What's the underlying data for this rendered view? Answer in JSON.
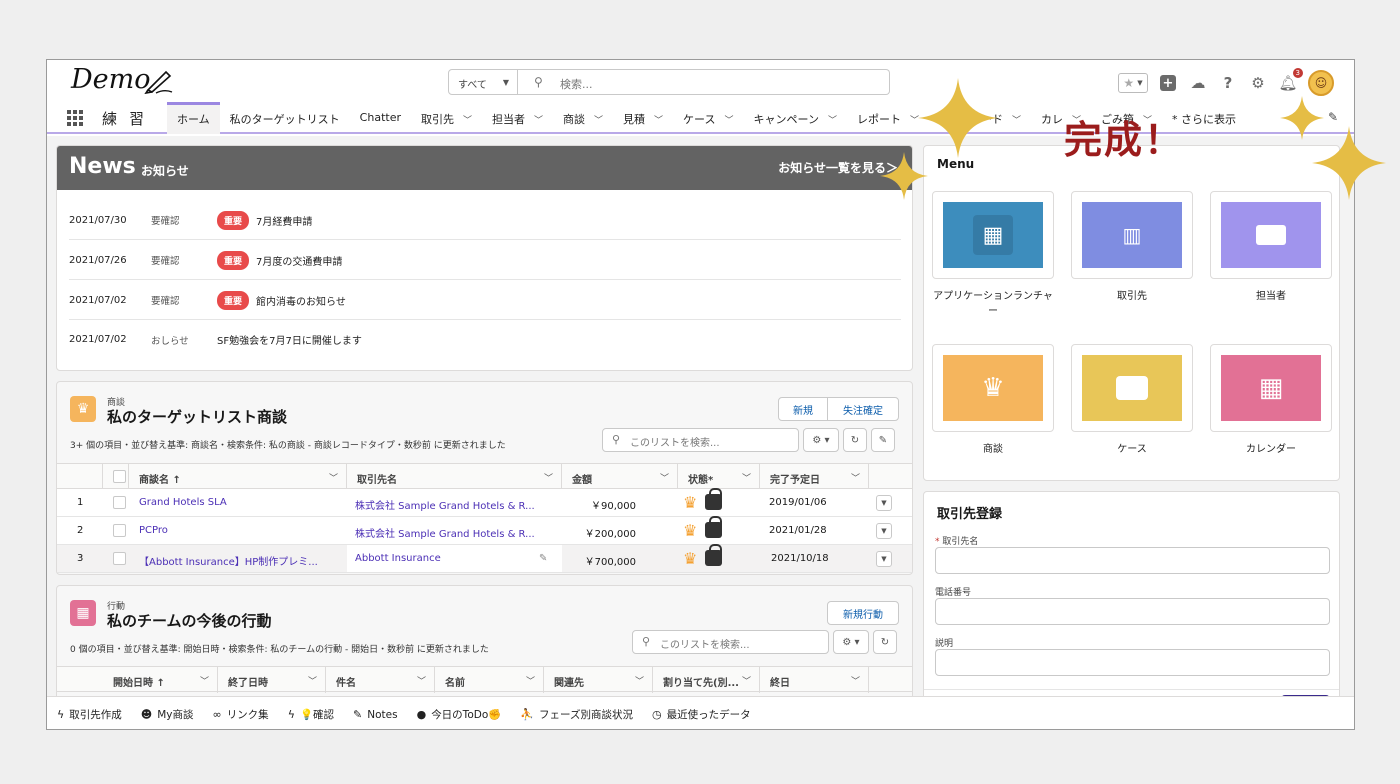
{
  "header": {
    "logo": "Demo",
    "search_scope": "すべて",
    "search_placeholder": "検索...",
    "notification_count": "3"
  },
  "nav": {
    "app_name": "練習",
    "tabs": [
      {
        "label": "ホーム"
      },
      {
        "label": "私のターゲットリスト"
      },
      {
        "label": "Chatter"
      },
      {
        "label": "取引先"
      },
      {
        "label": "担当者"
      },
      {
        "label": "商談"
      },
      {
        "label": "見積"
      },
      {
        "label": "ケース"
      },
      {
        "label": "キャンペーン"
      },
      {
        "label": "レポート"
      },
      {
        "label": "ード"
      },
      {
        "label": "カレ"
      },
      {
        "label": "ごみ箱"
      },
      {
        "label": "* さらに表示"
      }
    ]
  },
  "news": {
    "title": "News",
    "subtitle": "お知らせ",
    "more": "お知らせ一覧を見る＞",
    "items": [
      {
        "date": "2021/07/30",
        "status": "要確認",
        "badge": "重要",
        "text": "7月経費申請"
      },
      {
        "date": "2021/07/26",
        "status": "要確認",
        "badge": "重要",
        "text": "7月度の交通費申請"
      },
      {
        "date": "2021/07/02",
        "status": "要確認",
        "badge": "重要",
        "text": "館内消毒のお知らせ"
      },
      {
        "date": "2021/07/02",
        "status": "おしらせ",
        "badge": "",
        "text": "SF勉強会を7月7日に開催します"
      }
    ]
  },
  "opps": {
    "object": "商談",
    "title": "私のターゲットリスト商談",
    "meta": "3+ 個の項目・並び替え基準: 商談名・検索条件: 私の商談 - 商談レコードタイプ・数秒前 に更新されました",
    "new_btn": "新規",
    "close_btn": "失注確定",
    "search_placeholder": "このリストを検索...",
    "columns": [
      "商談名 ↑",
      "取引先名",
      "金額",
      "状態*",
      "完了予定日"
    ],
    "rows": [
      {
        "num": "1",
        "name": "Grand Hotels SLA",
        "account": "株式会社 Sample Grand Hotels & R...",
        "amount": "￥90,000",
        "date": "2019/01/06"
      },
      {
        "num": "2",
        "name": "PCPro",
        "account": "株式会社 Sample Grand Hotels & R...",
        "amount": "￥200,000",
        "date": "2021/01/28"
      },
      {
        "num": "3",
        "name": "【Abbott Insurance】HP制作プレミ...",
        "account": "Abbott Insurance",
        "amount": "￥700,000",
        "date": "2021/10/18"
      }
    ]
  },
  "acts": {
    "object": "行動",
    "title": "私のチームの今後の行動",
    "meta": "0 個の項目・並び替え基準: 開始日時・検索条件: 私のチームの行動 - 開始日・数秒前 に更新されました",
    "new_btn": "新規行動",
    "search_placeholder": "このリストを検索...",
    "columns": [
      "開始日時 ↑",
      "終了日時",
      "件名",
      "名前",
      "関連先",
      "割り当て先(別...",
      "終日"
    ]
  },
  "menu": {
    "title": "Menu",
    "tiles": [
      {
        "label": "アプリケーションランチャー",
        "icon": "grid-icon",
        "color": "#3d8dbd"
      },
      {
        "label": "取引先",
        "icon": "building-icon",
        "color": "#7f8de1"
      },
      {
        "label": "担当者",
        "icon": "contact-card-icon",
        "color": "#a094ed"
      },
      {
        "label": "商談",
        "icon": "crown-icon",
        "color": "#f5b55d"
      },
      {
        "label": "ケース",
        "icon": "briefcase-icon",
        "color": "#e8c658"
      },
      {
        "label": "カレンダー",
        "icon": "calendar-icon",
        "color": "#e27195"
      }
    ]
  },
  "account_form": {
    "title": "取引先登録",
    "fields": [
      {
        "label": "取引先名",
        "required": true
      },
      {
        "label": "電話番号",
        "required": false
      },
      {
        "label": "説明",
        "required": false
      }
    ]
  },
  "utility_bar": [
    {
      "label": "取引先作成",
      "icon": "bolt-icon"
    },
    {
      "label": "My商談",
      "icon": "face-icon"
    },
    {
      "label": "リンク集",
      "icon": "link-icon"
    },
    {
      "label": "💡確認",
      "icon": "bolt-icon"
    },
    {
      "label": "Notes",
      "icon": "notes-icon"
    },
    {
      "label": "今日のToDo✊",
      "icon": "chat-icon"
    },
    {
      "label": "フェーズ別商談状況",
      "icon": "runner-icon"
    },
    {
      "label": "最近使ったデータ",
      "icon": "clock-icon"
    }
  ],
  "overlay": {
    "text": "完成！",
    "sparkle_color": "#e5bd45"
  }
}
